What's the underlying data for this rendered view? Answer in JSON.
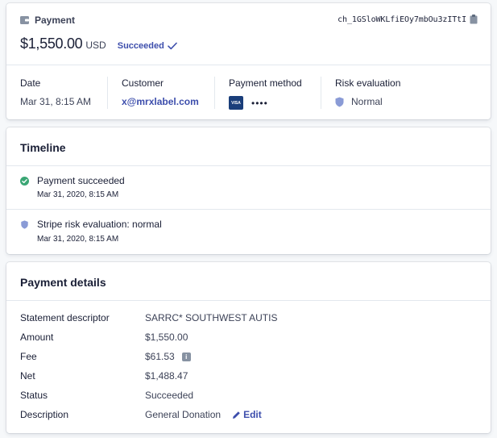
{
  "summary": {
    "label": "Payment",
    "charge_id": "ch_1GSloWKLfiEOy7mbOu3zITtI",
    "amount": "$1,550.00",
    "currency": "USD",
    "status": "Succeeded",
    "meta": [
      {
        "label": "Date",
        "value": "Mar 31, 8:15 AM"
      },
      {
        "label": "Customer",
        "value": "x@mrxlabel.com"
      },
      {
        "label": "Payment method",
        "card_brand": "VISA",
        "value": "••••"
      },
      {
        "label": "Risk evaluation",
        "value": "Normal"
      }
    ]
  },
  "timeline": {
    "title": "Timeline",
    "items": [
      {
        "title": "Payment succeeded",
        "time": "Mar 31, 2020, 8:15 AM",
        "icon": "check-circle-icon"
      },
      {
        "title": "Stripe risk evaluation: normal",
        "time": "Mar 31, 2020, 8:15 AM",
        "icon": "shield-icon"
      }
    ]
  },
  "details": {
    "title": "Payment details",
    "rows": [
      {
        "label": "Statement descriptor",
        "value": "SARRC* SOUTHWEST AUTIS"
      },
      {
        "label": "Amount",
        "value": "$1,550.00"
      },
      {
        "label": "Fee",
        "value": "$61.53"
      },
      {
        "label": "Net",
        "value": "$1,488.47"
      },
      {
        "label": "Status",
        "value": "Succeeded"
      },
      {
        "label": "Description",
        "value": "General Donation"
      }
    ],
    "edit_label": "Edit"
  },
  "colors": {
    "accent": "#3d4eac",
    "success": "#3aa674",
    "shield": "#8a9bd6",
    "text": "#1a1f36",
    "muted": "#3c4257"
  }
}
